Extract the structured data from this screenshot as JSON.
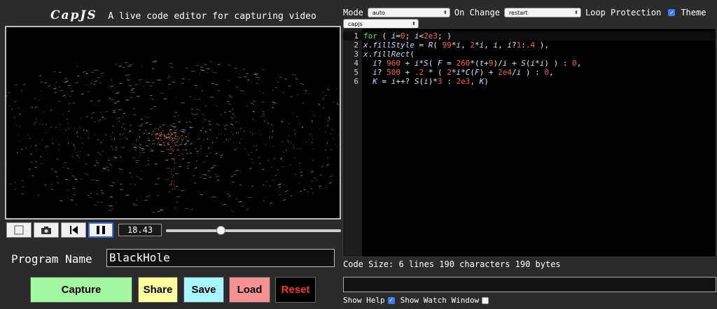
{
  "app": {
    "logo": "CapJS",
    "subtitle": "A live code editor for capturing video"
  },
  "player": {
    "time": "18.43",
    "progress_fraction": 0.31
  },
  "program": {
    "label": "Program Name",
    "name": "BlackHole"
  },
  "actions": {
    "capture": "Capture",
    "share": "Share",
    "save": "Save",
    "load": "Load",
    "reset": "Reset"
  },
  "toolbar": {
    "mode_label": "Mode",
    "mode_value": "auto",
    "on_change_label": "On Change",
    "on_change_value": "restart",
    "loop_protection_label": "Loop Protection",
    "loop_protection_checked": true,
    "theme_label": "Theme",
    "theme_checked": true,
    "theme_value": "capjs"
  },
  "editor": {
    "lines": [
      "for ( i=0; i<2e3; )",
      "x.fillStyle = R( 99*i, 2*i, i, i?1:.4 ),",
      "x.fillRect(",
      "  i? 960 + i*S( F = 260*(t+9)/i + S(i*i) ) : 0,",
      "  i? 500 + .2 * ( 2*i*C(F) + 2e4/i ) : 0,",
      "  K = i++? S(i)*3 : 2e3, K)"
    ],
    "code_size": "Code Size: 6 lines 190 characters 190 bytes"
  },
  "footer": {
    "show_help_label": "Show Help",
    "show_help_checked": true,
    "show_watch_label": "Show Watch Window",
    "show_watch_checked": false
  },
  "colors": {
    "capture": "#a3f7a0",
    "share": "#ffff9e",
    "save": "#a6f6ff",
    "load": "#f59393",
    "reset_text": "#ff2f2f",
    "keyword": "#4be04b",
    "number": "#ff5a4a"
  }
}
